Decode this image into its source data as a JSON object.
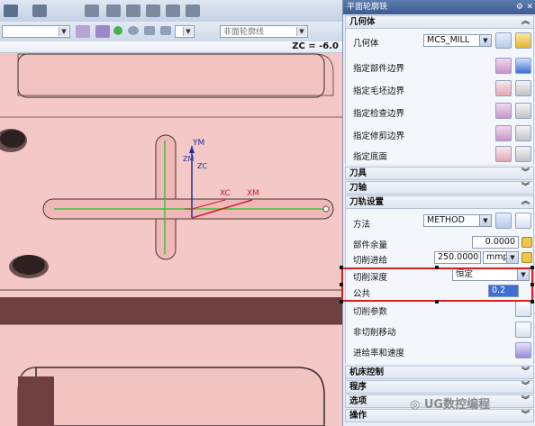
{
  "toolbar": {
    "view_combo": "",
    "filter_combo": "非面轮廓线"
  },
  "viewport": {
    "zc_label": "ZC = -6.0",
    "axis_labels": {
      "ym": "YM",
      "zm": "ZM",
      "zc": "ZC",
      "xc": "XC",
      "xm": "XM"
    }
  },
  "panel": {
    "title": "平面轮廓铣",
    "geometry": {
      "header": "几何体",
      "geometry_label": "几何体",
      "geometry_value": "MCS_MILL",
      "rows": [
        "指定部件边界",
        "指定毛坯边界",
        "指定检查边界",
        "指定修剪边界",
        "指定底面"
      ]
    },
    "tool_header": "刀具",
    "axis_header": "刀轴",
    "path": {
      "header": "刀轨设置",
      "method_label": "方法",
      "method_value": "METHOD",
      "part_stock_label": "部件余量",
      "part_stock_value": "0.0000",
      "feed_label": "切削进给",
      "feed_value": "250.0000",
      "feed_unit": "mmpr",
      "depth_label": "切削深度",
      "depth_value": "恒定",
      "common_label": "公共",
      "common_value": "0.2",
      "cut_params": "切削参数",
      "non_cut": "非切削移动",
      "feeds_speeds": "进给率和速度"
    },
    "machine_control": "机床控制",
    "program": "程序",
    "options": "选项",
    "actions": "操作"
  },
  "watermark": "UG数控编程"
}
